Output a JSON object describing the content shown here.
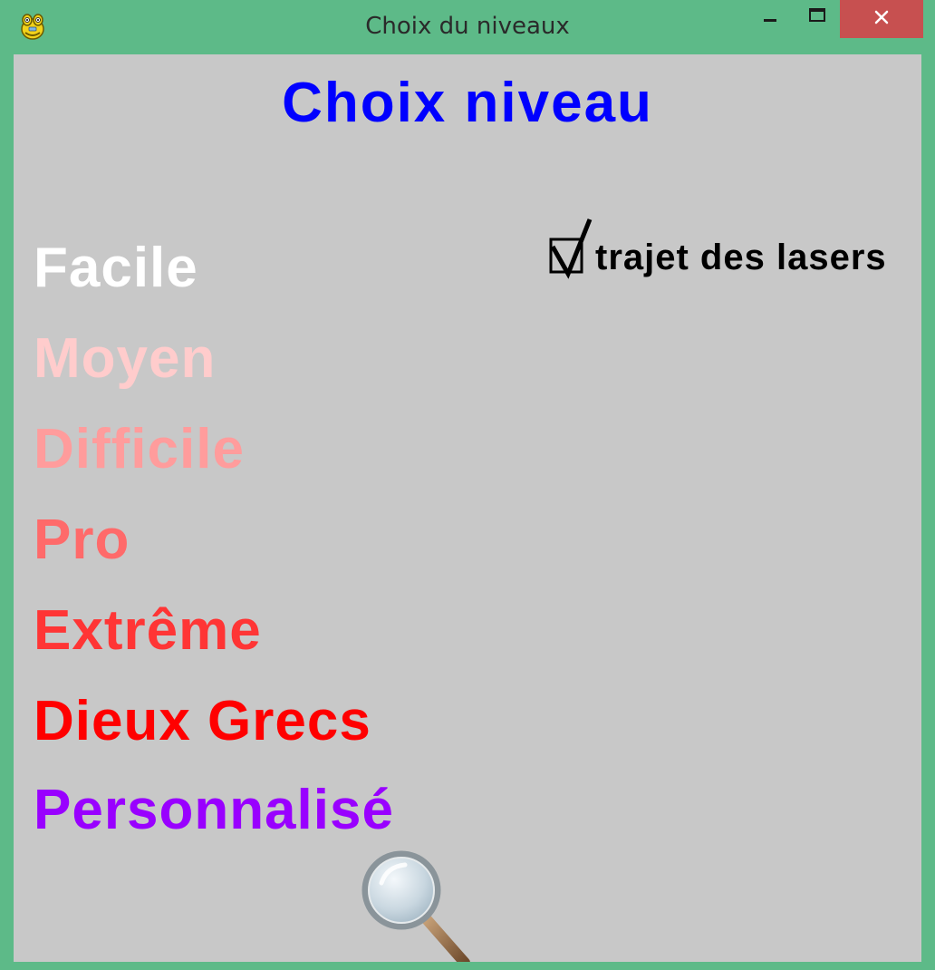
{
  "window": {
    "title": "Choix du niveaux",
    "icon": "pygame-snake-icon",
    "controls": {
      "minimize": "minimize-icon",
      "maximize": "maximize-icon",
      "close": "close-icon"
    },
    "colors": {
      "frame": "#5dba88",
      "close_button": "#c75050",
      "client_background": "#c8c8c8"
    }
  },
  "screen": {
    "heading": "Choix niveau",
    "heading_color": "#0000ff",
    "levels": [
      {
        "label": "Facile",
        "color": "#ffffff"
      },
      {
        "label": "Moyen",
        "color": "#ffcccc"
      },
      {
        "label": "Difficile",
        "color": "#ff9c9c"
      },
      {
        "label": "Pro",
        "color": "#ff6a6a"
      },
      {
        "label": "Extrême",
        "color": "#ff3535"
      },
      {
        "label": "Dieux Grecs",
        "color": "#ff0000"
      },
      {
        "label": "Personnalisé",
        "color": "#9900ff"
      }
    ],
    "laser_option": {
      "label": "trajet des lasers",
      "checked": true
    },
    "search_icon": "magnifier-icon"
  }
}
